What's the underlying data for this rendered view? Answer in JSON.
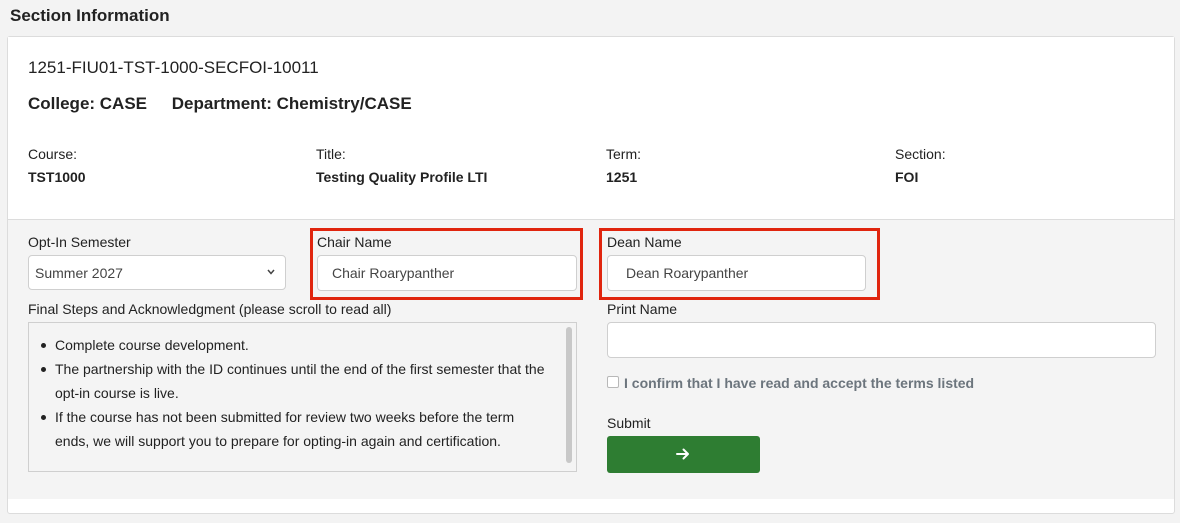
{
  "header": {
    "title": "Section Information"
  },
  "section": {
    "id": "1251-FIU01-TST-1000-SECFOI-10011",
    "college": "College: CASE",
    "department": "Department: Chemistry/CASE"
  },
  "meta": [
    {
      "label": "Course:",
      "value": "TST1000"
    },
    {
      "label": "Title:",
      "value": "Testing Quality Profile LTI"
    },
    {
      "label": "Term:",
      "value": "1251"
    },
    {
      "label": "Section:",
      "value": "FOI"
    }
  ],
  "form": {
    "semester_label": "Opt-In Semester",
    "semester_value": "Summer 2027",
    "chair_label": "Chair Name",
    "chair_value": "Chair Roarypanther",
    "dean_label": "Dean Name",
    "dean_value": "Dean Roarypanther",
    "final_steps_label": "Final Steps and Acknowledgment (please scroll to read all)",
    "terms": [
      "Complete course development.",
      "The partnership with the ID continues until the end of the first semester that the opt-in course is live.",
      "If the course has not been submitted for review two weeks before the term ends, we will support you to prepare for opting-in again and certification."
    ],
    "print_name_label": "Print Name",
    "print_name_value": "",
    "confirm_label": "I confirm that I have read and accept the terms listed",
    "submit_label": "Submit"
  },
  "colors": {
    "highlight": "#e0250e",
    "submit": "#2e7d32"
  },
  "icons": {
    "submit": "arrow-right-icon",
    "select": "chevron-down-icon"
  }
}
